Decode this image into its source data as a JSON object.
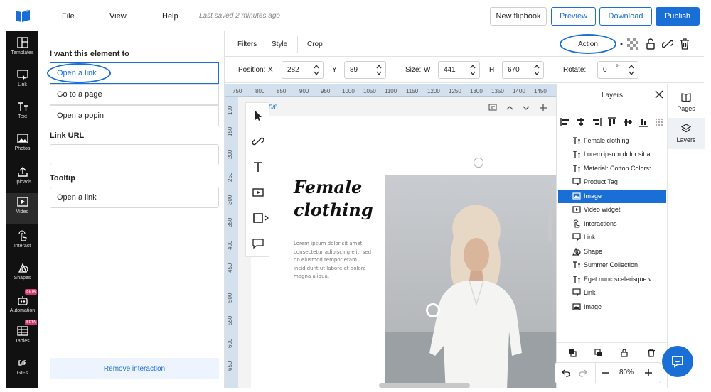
{
  "topbar": {
    "menu": [
      "File",
      "View",
      "Help"
    ],
    "saved_status": "Last saved 2 minutes ago",
    "buttons": {
      "new": "New flipbook",
      "preview": "Preview",
      "download": "Download",
      "publish": "Publish"
    }
  },
  "sidebar": {
    "items": [
      {
        "label": "Templates",
        "icon": "templates-icon"
      },
      {
        "label": "Link",
        "icon": "link-icon"
      },
      {
        "label": "Text",
        "icon": "text-icon"
      },
      {
        "label": "Photos",
        "icon": "photos-icon"
      },
      {
        "label": "Uploads",
        "icon": "upload-icon"
      },
      {
        "label": "Video",
        "icon": "video-icon"
      },
      {
        "label": "Interact",
        "icon": "interact-icon"
      },
      {
        "label": "Shapes",
        "icon": "shapes-icon"
      },
      {
        "label": "Automation",
        "icon": "robot-icon",
        "badge": "BETA"
      },
      {
        "label": "Tables",
        "icon": "table-icon",
        "badge": "BETA"
      },
      {
        "label": "GIFs",
        "icon": "gif-icon"
      }
    ]
  },
  "panel": {
    "heading": "I want this element to",
    "options": [
      "Open a link",
      "Go to a page",
      "Open a popin"
    ],
    "link_url_label": "Link URL",
    "link_url_value": "",
    "tooltip_label": "Tooltip",
    "tooltip_value": "Open a link",
    "remove_button": "Remove interaction"
  },
  "toolbar": {
    "tabs": [
      "Filters",
      "Style",
      "Crop"
    ],
    "action_label": "Action"
  },
  "position": {
    "position_label": "Position:",
    "x_label": "X",
    "x_value": "282",
    "y_label": "Y",
    "y_value": "89",
    "size_label": "Size:",
    "w_label": "W",
    "w_value": "441",
    "h_label": "H",
    "h_value": "670",
    "rotate_label": "Rotate:",
    "rotate_value": "0",
    "rotate_unit": "°"
  },
  "ruler": {
    "top": [
      "750",
      "800",
      "850",
      "900",
      "950",
      "1000",
      "1050",
      "1100",
      "1150",
      "1200",
      "1250",
      "1300",
      "1350",
      "1400",
      "1450"
    ],
    "left": [
      "100",
      "150",
      "200",
      "250",
      "300",
      "350",
      "400",
      "450",
      "500",
      "550",
      "600",
      "650"
    ]
  },
  "canvas": {
    "page_counter": "5/8",
    "heading_line1": "Female",
    "heading_line2": "clothing",
    "lorem": "Lorem ipsum dolor sit amet, consectetur adipiscing elit, sed do eiusmod tempor etam incididunt ut labore et dolore magna aliqua."
  },
  "layers": {
    "title": "Layers",
    "items": [
      {
        "label": "Female clothing",
        "icon": "text-icon"
      },
      {
        "label": "Lorem ipsum dolor sit a",
        "icon": "text-icon"
      },
      {
        "label": "Material: Cotton Colors:",
        "icon": "text-icon"
      },
      {
        "label": "Product Tag",
        "icon": "link-icon"
      },
      {
        "label": "Image",
        "icon": "image-icon",
        "selected": true
      },
      {
        "label": "Video widget",
        "icon": "video-icon"
      },
      {
        "label": "Interactions",
        "icon": "interact-icon"
      },
      {
        "label": "Link",
        "icon": "link-icon"
      },
      {
        "label": "Shape",
        "icon": "shapes-icon"
      },
      {
        "label": "Summer Collection",
        "icon": "text-icon"
      },
      {
        "label": "Eget nunc scelerisque v",
        "icon": "text-icon"
      },
      {
        "label": "Link",
        "icon": "link-icon"
      },
      {
        "label": "Image",
        "icon": "image-icon"
      }
    ]
  },
  "right_tabs": [
    {
      "label": "Pages",
      "icon": "pages-icon"
    },
    {
      "label": "Layers",
      "icon": "layers-icon"
    }
  ],
  "zoom": {
    "value": "80%"
  },
  "colors": {
    "accent": "#1a6fd6",
    "sidebar_bg": "#111111",
    "ruler_bg": "#d3e1ef"
  }
}
